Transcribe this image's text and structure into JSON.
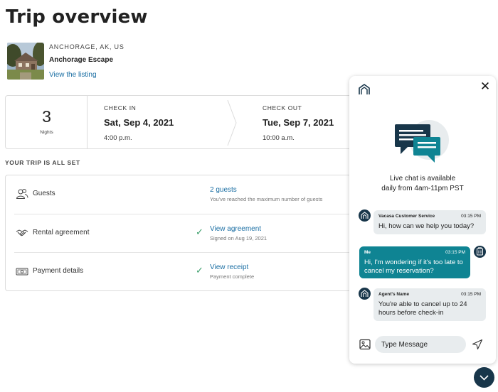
{
  "page": {
    "title": "Trip overview"
  },
  "property": {
    "location": "ANCHORAGE, AK, US",
    "name": "Anchorage Escape",
    "link": "View the listing"
  },
  "stay": {
    "nights_count": "3",
    "nights_label": "Nights",
    "check_in": {
      "label": "CHECK IN",
      "date": "Sat, Sep 4, 2021",
      "time": "4:00 p.m."
    },
    "check_out": {
      "label": "CHECK OUT",
      "date": "Tue, Sep 7, 2021",
      "time": "10:00 a.m."
    }
  },
  "checklist": {
    "heading": "YOUR TRIP IS ALL SET",
    "items": [
      {
        "label": "Guests",
        "icon": "guests-icon",
        "status": "2 guests",
        "detail": "You've reached the maximum number of guests",
        "checked": false
      },
      {
        "label": "Rental agreement",
        "icon": "handshake-icon",
        "status": "View agreement",
        "detail": "Signed on Aug 19, 2021",
        "checked": true
      },
      {
        "label": "Payment details",
        "icon": "money-icon",
        "status": "View receipt",
        "detail": "Payment complete",
        "checked": true
      }
    ]
  },
  "chat": {
    "availability_line1": "Live chat is available",
    "availability_line2": "daily from 4am-11pm PST",
    "messages": [
      {
        "sender": "Vacasa Customer Service",
        "time": "03:15 PM",
        "text": "Hi, how can we help you today?",
        "from_me": false
      },
      {
        "sender": "Me",
        "time": "03:15 PM",
        "text": "Hi, I'm wondering if it's too late to cancel my reservation?",
        "from_me": true
      },
      {
        "sender": "Agent's Name",
        "time": "03:15 PM",
        "text": "You're able to cancel up to 24 hours before check-in",
        "from_me": false
      }
    ],
    "input_placeholder": "Type Message"
  },
  "colors": {
    "link": "#1a6ea3",
    "check": "#3a9e6a",
    "chat_me_bubble": "#0f8493",
    "chat_agent_bubble": "#e8ecee",
    "brand_navy": "#18364a"
  }
}
